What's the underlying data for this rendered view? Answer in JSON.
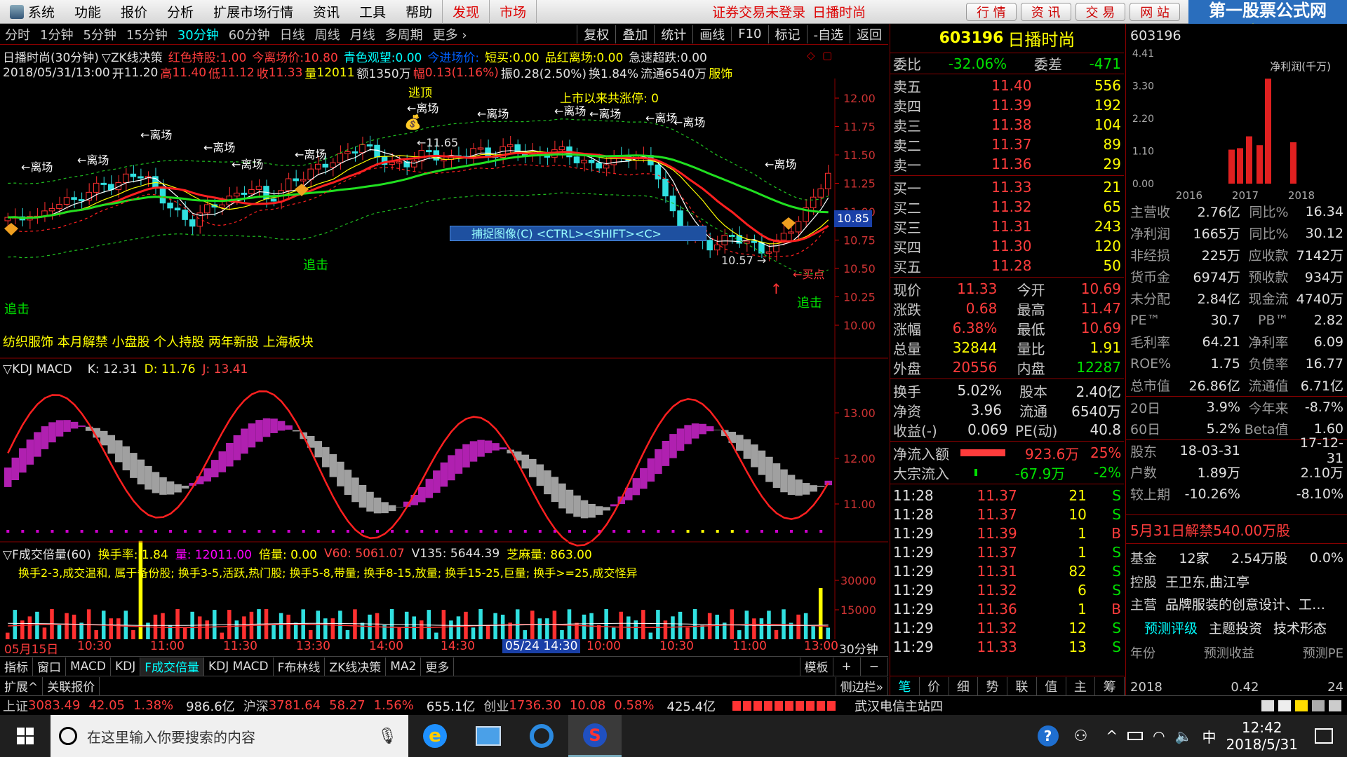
{
  "menu": {
    "items": [
      "系统",
      "功能",
      "报价",
      "分析",
      "扩展市场行情",
      "资讯",
      "工具",
      "帮助"
    ],
    "discover": "发现",
    "market": "市场",
    "login_status": "证券交易未登录",
    "stock_name": "日播时尚",
    "right_btns": [
      "行 情",
      "资 讯",
      "交 易",
      "网 站"
    ]
  },
  "logo": {
    "title": "第一股票公式网",
    "url": "www.chnmoney.com"
  },
  "periods": {
    "items": [
      "分时",
      "1分钟",
      "5分钟",
      "15分钟",
      "30分钟",
      "60分钟",
      "日线",
      "周线",
      "月线",
      "多周期",
      "更多"
    ],
    "active": "30分钟",
    "tools": [
      "复权",
      "叠加",
      "统计",
      "画线",
      "F10",
      "标记",
      "-自选",
      "返回"
    ]
  },
  "main_chart": {
    "title": "日播时尚(30分钟)",
    "indicator": "▽ZK线决策",
    "legend": [
      {
        "k": "红色持股:",
        "v": "1.00",
        "c": "#ff3c3c"
      },
      {
        "k": "今离场价:",
        "v": "10.80",
        "c": "#ff3c3c"
      },
      {
        "k": "青色观望:",
        "v": "0.00",
        "c": "#00ffff"
      },
      {
        "k": "今进场价:",
        "v": "",
        "c": "#0060ff"
      },
      {
        "k": "短买:",
        "v": "0.00",
        "c": "#ffff00"
      },
      {
        "k": "品红离场:",
        "v": "0.00",
        "c": "#ffff00"
      },
      {
        "k": "急速超跌:",
        "v": "0.00",
        "c": "#e0e0e0"
      }
    ],
    "info": {
      "date": "2018/05/31/13:00",
      "open_k": "开",
      "open": "11.20",
      "high_k": "高",
      "high": "11.40",
      "low_k": "低",
      "low": "11.12",
      "close_k": "收",
      "close": "11.33",
      "vol_k": "量",
      "vol": "12011",
      "amt": "额1350万",
      "amp_k": "幅",
      "amp": "0.13(1.16%)",
      "zhen": "振0.28(2.50%)",
      "hs": "换1.84%",
      "lt": "流通6540万",
      "sector": "服饰"
    },
    "labels": {
      "escape": "逃顶",
      "rise_count": "上市以来共涨停:",
      "rise_val": "0",
      "chase": "追击",
      "buy": "买点",
      "capture": "捕捉图像(C)   <CTRL><SHIFT><C>",
      "price_tag": "10.85",
      "low_tag": "10.57",
      "high_tag": "11.65",
      "exit": "离场"
    },
    "yaxis": [
      "12.00",
      "11.75",
      "11.50",
      "11.25",
      "11.00",
      "10.75",
      "10.50",
      "10.25",
      "10.00"
    ],
    "tags": "纺织服饰 本月解禁 小盘股 个人持股 两年新股 上海板块"
  },
  "kdj": {
    "title": "▽KDJ MACD",
    "k": "K: 12.31",
    "d": "D: 11.76",
    "j": "J: 13.41",
    "yaxis": [
      "13.00",
      "12.00",
      "11.00"
    ]
  },
  "vol": {
    "title": "▽F成交倍量(60)",
    "hs": "换手率: 1.84",
    "liang": "量: 12011.00",
    "bei": "倍量: 0.00",
    "v60": "V60: 5061.07",
    "v135": "V135: 5644.39",
    "zhima": "芝麻量: 863.00",
    "desc": "换手2-3,成交温和,  属于备份股;  换手3-5,活跃,热门股;  换手5-8,带量;  换手8-15,放量;  换手15-25,巨量;  换手>=25,成交怪异",
    "yaxis": [
      "30000",
      "15000"
    ]
  },
  "xaxis": [
    "05月15日",
    "10:30",
    "11:00",
    "11:30",
    "13:30",
    "14:00",
    "14:30",
    "05/24 14:30",
    "10:00",
    "10:30",
    "11:00",
    "13:00"
  ],
  "xaxis_period": "30分钟",
  "bottom_tabs": [
    "指标",
    "窗口",
    "MACD",
    "KDJ",
    "F成交倍量",
    "KDJ MACD",
    "F布林线",
    "ZK线决策",
    "MA2",
    "更多"
  ],
  "bottom_right": [
    "模板",
    "+",
    "−"
  ],
  "bottom2": [
    "扩展^",
    "关联报价"
  ],
  "bottom2_right": "侧边栏»",
  "quote": {
    "code": "603196",
    "name": "日播时尚",
    "wb_k": "委比",
    "wb": "-32.06%",
    "wc_k": "委差",
    "wc": "-471",
    "sell": [
      {
        "k": "卖五",
        "p": "11.40",
        "v": "556"
      },
      {
        "k": "卖四",
        "p": "11.39",
        "v": "192"
      },
      {
        "k": "卖三",
        "p": "11.38",
        "v": "104"
      },
      {
        "k": "卖二",
        "p": "11.37",
        "v": "89"
      },
      {
        "k": "卖一",
        "p": "11.36",
        "v": "29"
      }
    ],
    "buy": [
      {
        "k": "买一",
        "p": "11.33",
        "v": "21"
      },
      {
        "k": "买二",
        "p": "11.32",
        "v": "65"
      },
      {
        "k": "买三",
        "p": "11.31",
        "v": "243"
      },
      {
        "k": "买四",
        "p": "11.30",
        "v": "120"
      },
      {
        "k": "买五",
        "p": "11.28",
        "v": "50"
      }
    ],
    "stats": [
      {
        "a": "现价",
        "av": "11.33",
        "b": "今开",
        "bv": "10.69",
        "ac": "#ff3c3c",
        "bc": "#ff3c3c"
      },
      {
        "a": "涨跌",
        "av": "0.68",
        "b": "最高",
        "bv": "11.47",
        "ac": "#ff3c3c",
        "bc": "#ff3c3c"
      },
      {
        "a": "涨幅",
        "av": "6.38%",
        "b": "最低",
        "bv": "10.69",
        "ac": "#ff3c3c",
        "bc": "#ff3c3c"
      },
      {
        "a": "总量",
        "av": "32844",
        "b": "量比",
        "bv": "1.91",
        "ac": "#ffff00",
        "bc": "#ffff00"
      },
      {
        "a": "外盘",
        "av": "20556",
        "b": "内盘",
        "bv": "12287",
        "ac": "#ff3c3c",
        "bc": "#00e000"
      }
    ],
    "stats2": [
      {
        "a": "换手",
        "av": "5.02%",
        "b": "股本",
        "bv": "2.40亿"
      },
      {
        "a": "净资",
        "av": "3.96",
        "b": "流通",
        "bv": "6540万"
      },
      {
        "a": "收益(-)",
        "av": "0.069",
        "b": "PE(动)",
        "bv": "40.8"
      }
    ],
    "flow": [
      {
        "k": "净流入额",
        "v": "923.6万",
        "p": "25%",
        "c": "#ff3c3c"
      },
      {
        "k": "大宗流入",
        "v": "-67.9万",
        "p": "-2%",
        "c": "#00e000"
      }
    ],
    "ticks": [
      {
        "t": "11:28",
        "p": "11.37",
        "v": "21",
        "s": "S"
      },
      {
        "t": "11:28",
        "p": "11.37",
        "v": "10",
        "s": "S"
      },
      {
        "t": "11:29",
        "p": "11.39",
        "v": "1",
        "s": "B"
      },
      {
        "t": "11:29",
        "p": "11.37",
        "v": "1",
        "s": "S"
      },
      {
        "t": "11:29",
        "p": "11.31",
        "v": "82",
        "s": "S"
      },
      {
        "t": "11:29",
        "p": "11.32",
        "v": "6",
        "s": "S"
      },
      {
        "t": "11:29",
        "p": "11.36",
        "v": "1",
        "s": "B"
      },
      {
        "t": "11:29",
        "p": "11.32",
        "v": "12",
        "s": "S"
      },
      {
        "t": "11:29",
        "p": "11.33",
        "v": "13",
        "s": "S"
      }
    ],
    "tabs": [
      "笔",
      "价",
      "细",
      "势",
      "联",
      "值",
      "主",
      "筹"
    ]
  },
  "fin": {
    "code": "603196",
    "chart_title": "净利润(千万)",
    "chart_data": {
      "type": "bar",
      "categories": [
        "2016",
        "2017",
        "2018"
      ],
      "yticks": [
        "4.41",
        "3.30",
        "2.20",
        "1.10",
        "0.00"
      ],
      "ylim": [
        0,
        4.41
      ],
      "values": [
        1.15,
        1.2,
        1.6,
        1.3,
        3.55,
        1.4
      ]
    },
    "rows": [
      {
        "a": "主营收",
        "av": "2.76亿",
        "b": "同比%",
        "bv": "16.34"
      },
      {
        "a": "净利润",
        "av": "1665万",
        "b": "同比%",
        "bv": "30.12"
      },
      {
        "a": "非经损",
        "av": "225万",
        "b": "应收款",
        "bv": "7142万"
      },
      {
        "a": "货币金",
        "av": "6974万",
        "b": "预收款",
        "bv": "934万"
      },
      {
        "a": "未分配",
        "av": "2.84亿",
        "b": "现金流",
        "bv": "4740万"
      },
      {
        "a": "PE™",
        "av": "30.7",
        "b": "PB™",
        "bv": "2.82"
      },
      {
        "a": "毛利率",
        "av": "64.21",
        "b": "净利率",
        "bv": "6.09"
      },
      {
        "a": "ROE%",
        "av": "1.75",
        "b": "负债率",
        "bv": "16.77"
      },
      {
        "a": "总市值",
        "av": "26.86亿",
        "b": "流通值",
        "bv": "6.71亿"
      },
      {
        "a": "20日",
        "av": "3.9%",
        "b": "今年来",
        "bv": "-8.7%"
      },
      {
        "a": "60日",
        "av": "5.2%",
        "b": "Beta值",
        "bv": "1.60"
      },
      {
        "a": "股东",
        "av": "18-03-31",
        "b": "",
        "bv": "17-12-31"
      },
      {
        "a": "户数",
        "av": "1.89万",
        "b": "",
        "bv": "2.10万"
      },
      {
        "a": "较上期",
        "av": "-10.26%",
        "b": "",
        "bv": "-8.10%"
      }
    ],
    "notice": "5月31日解禁540.00万股",
    "fund_k": "基金",
    "fund_n": "12家",
    "fund_v": "2.54万股",
    "fund_p": "0.0%",
    "ctrl_k": "控股",
    "ctrl_v": "王卫东,曲江亭",
    "main_k": "主营",
    "main_v": "品牌服装的创意设计、工…",
    "links": [
      "预测评级",
      "主题投资",
      "技术形态"
    ],
    "pred_h": [
      "年份",
      "预测收益",
      "预测PE"
    ],
    "pred_r": [
      "2018",
      "0.42",
      "24"
    ]
  },
  "status": {
    "sh_k": "上证",
    "sh": "3083.49",
    "sh_c": "42.05",
    "sh_p": "1.38%",
    "sh_a": "986.6亿",
    "hs_k": "沪深",
    "hs": "3781.64",
    "hs_c": "58.27",
    "hs_p": "1.56%",
    "hs_a": "655.1亿",
    "cy_k": "创业",
    "cy": "1736.30",
    "cy_c": "10.08",
    "cy_p": "0.58%",
    "cy_a": "425.4亿",
    "station": "武汉电信主站四"
  },
  "taskbar": {
    "search": "在这里输入你要搜索的内容",
    "ime": "中",
    "time": "12:42",
    "date": "2018/5/31"
  }
}
